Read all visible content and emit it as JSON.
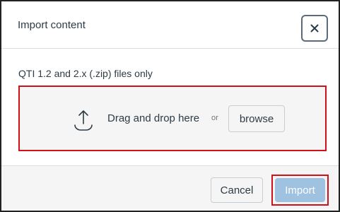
{
  "dialog": {
    "title": "Import content",
    "close_icon": "close-icon",
    "file_hint": "QTI 1.2 and 2.x (.zip) files only",
    "dropzone": {
      "icon": "upload-icon",
      "drag_text": "Drag and drop here",
      "or_text": "or",
      "browse_label": "browse"
    },
    "footer": {
      "cancel_label": "Cancel",
      "import_label": "Import"
    }
  },
  "colors": {
    "highlight_outline": "#d0101b",
    "primary_disabled": "#9fc2e0",
    "text": "#2d3b45"
  }
}
